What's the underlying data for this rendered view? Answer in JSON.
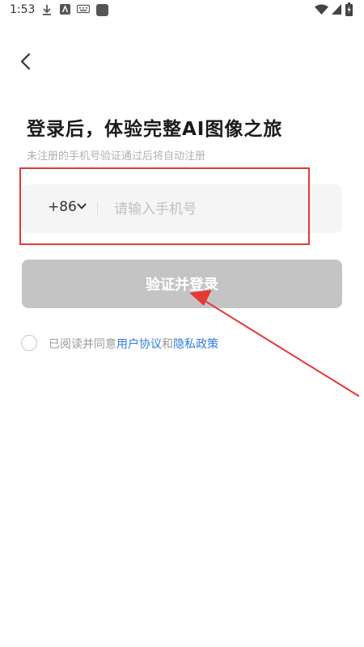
{
  "status_bar": {
    "time": "1:53"
  },
  "header": {
    "back_icon": "chevron-left-icon"
  },
  "main": {
    "title": "登录后，体验完整AI图像之旅",
    "subtitle": "未注册的手机号验证通过后将自动注册",
    "phone": {
      "country_code": "+86",
      "placeholder": "请输入手机号",
      "value": ""
    },
    "login_button": "验证并登录",
    "agreement": {
      "prefix": "已阅读并同意",
      "user_agreement": "用户协议",
      "conjunction": "和",
      "privacy_policy": "隐私政策",
      "checked": false
    }
  },
  "annotations": {
    "highlight_color": "#e53935",
    "arrow_color": "#e53935"
  },
  "colors": {
    "link": "#2f7de1",
    "button_disabled": "#c4c4c4",
    "input_bg": "#f5f5f5"
  }
}
